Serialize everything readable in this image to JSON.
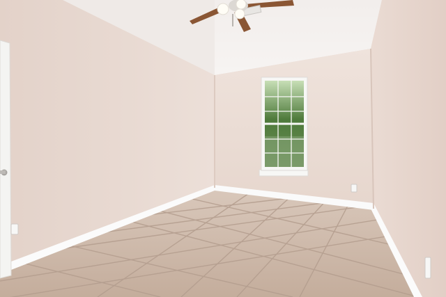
{
  "scene": {
    "kind": "photograph",
    "subject": "empty-bedroom",
    "colors": {
      "left_wall": "#e8d9d1",
      "back_wall": "#eadcd4",
      "right_wall": "#ecdfd8",
      "ceiling": "#f4f0ee",
      "floor_tile": "#cdb8a8",
      "grout": "#b8a192",
      "baseboard": "#fbfbfb",
      "window_frame": "#f7f7f5",
      "foliage": "#4f7a3c",
      "fan_blade": "#8a5634"
    },
    "objects": [
      {
        "name": "ceiling-fan",
        "icon": "ceiling-fan-icon"
      },
      {
        "name": "window",
        "icon": "window-icon"
      },
      {
        "name": "open-door",
        "icon": "door-icon"
      },
      {
        "name": "wall-outlet",
        "icon": "outlet-icon"
      },
      {
        "name": "tile-floor",
        "icon": "tile-floor-icon"
      }
    ]
  }
}
